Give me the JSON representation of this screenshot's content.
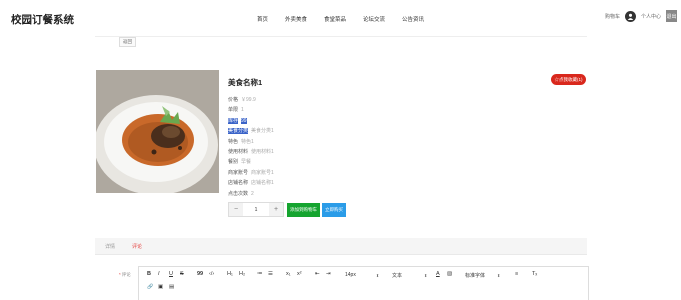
{
  "header": {
    "brand": "校园订餐系统",
    "menu": [
      {
        "label": "首页"
      },
      {
        "label": "外卖美食"
      },
      {
        "label": "食堂菜品"
      },
      {
        "label": "论坛交流"
      },
      {
        "label": "公告资讯"
      }
    ],
    "cart_label": "购物车",
    "user_center_label": "个人中心",
    "logout_label": "退出"
  },
  "subbar": {
    "back_label": "返回"
  },
  "product": {
    "title": "美食名称1",
    "favorite_label": "☆点我收藏(1)",
    "fields": [
      {
        "label": "价格",
        "value": "￥99.9",
        "highlight": false
      },
      {
        "label": "单限",
        "value": "1",
        "highlight": false
      },
      {
        "label": "库存",
        "value": "99",
        "highlight": true
      },
      {
        "label": "美食分类",
        "value": "美食分类1",
        "highlight": true
      },
      {
        "label": "特色",
        "value": "特色1",
        "highlight": false
      },
      {
        "label": "使用材料",
        "value": "使用材料1",
        "highlight": false
      },
      {
        "label": "餐别",
        "value": "早餐",
        "highlight": false
      },
      {
        "label": "商家账号",
        "value": "商家账号1",
        "highlight": false
      },
      {
        "label": "店铺名称",
        "value": "店铺名称1",
        "highlight": false
      },
      {
        "label": "点击次数",
        "value": "2",
        "highlight": false
      }
    ],
    "quantity": "1",
    "minus_label": "−",
    "plus_label": "+",
    "add_cart_label": "添加到购物车",
    "buy_now_label": "立即购买"
  },
  "tabs": [
    {
      "label": "详情",
      "active": false
    },
    {
      "label": "评论",
      "active": true
    }
  ],
  "editor": {
    "label": "评论",
    "row1": {
      "bold": "B",
      "italic": "I",
      "underline": "U",
      "strike": "S",
      "quote": "99",
      "code": "‹/›",
      "h1": "H₁",
      "h2": "H₂",
      "ordered_list": "≔",
      "bullet_list": "☰",
      "subscript": "x₁",
      "superscript": "x²",
      "outdent": "⇤",
      "indent": "⇥",
      "font_size": "14px",
      "text_style": "文本",
      "font_color": "A",
      "background_color": "▧",
      "font_family": "标准字体",
      "align": "≡",
      "clear_format": "Tₓ"
    },
    "row2": {
      "link": "🔗",
      "image": "▣",
      "video": "▤"
    }
  },
  "colors": {
    "favorite_red": "#d9281d",
    "cart_green": "#15a42f",
    "buy_blue": "#2b9ce8",
    "selection_blue": "#3a63c8",
    "tab_active_red": "#e64340"
  }
}
